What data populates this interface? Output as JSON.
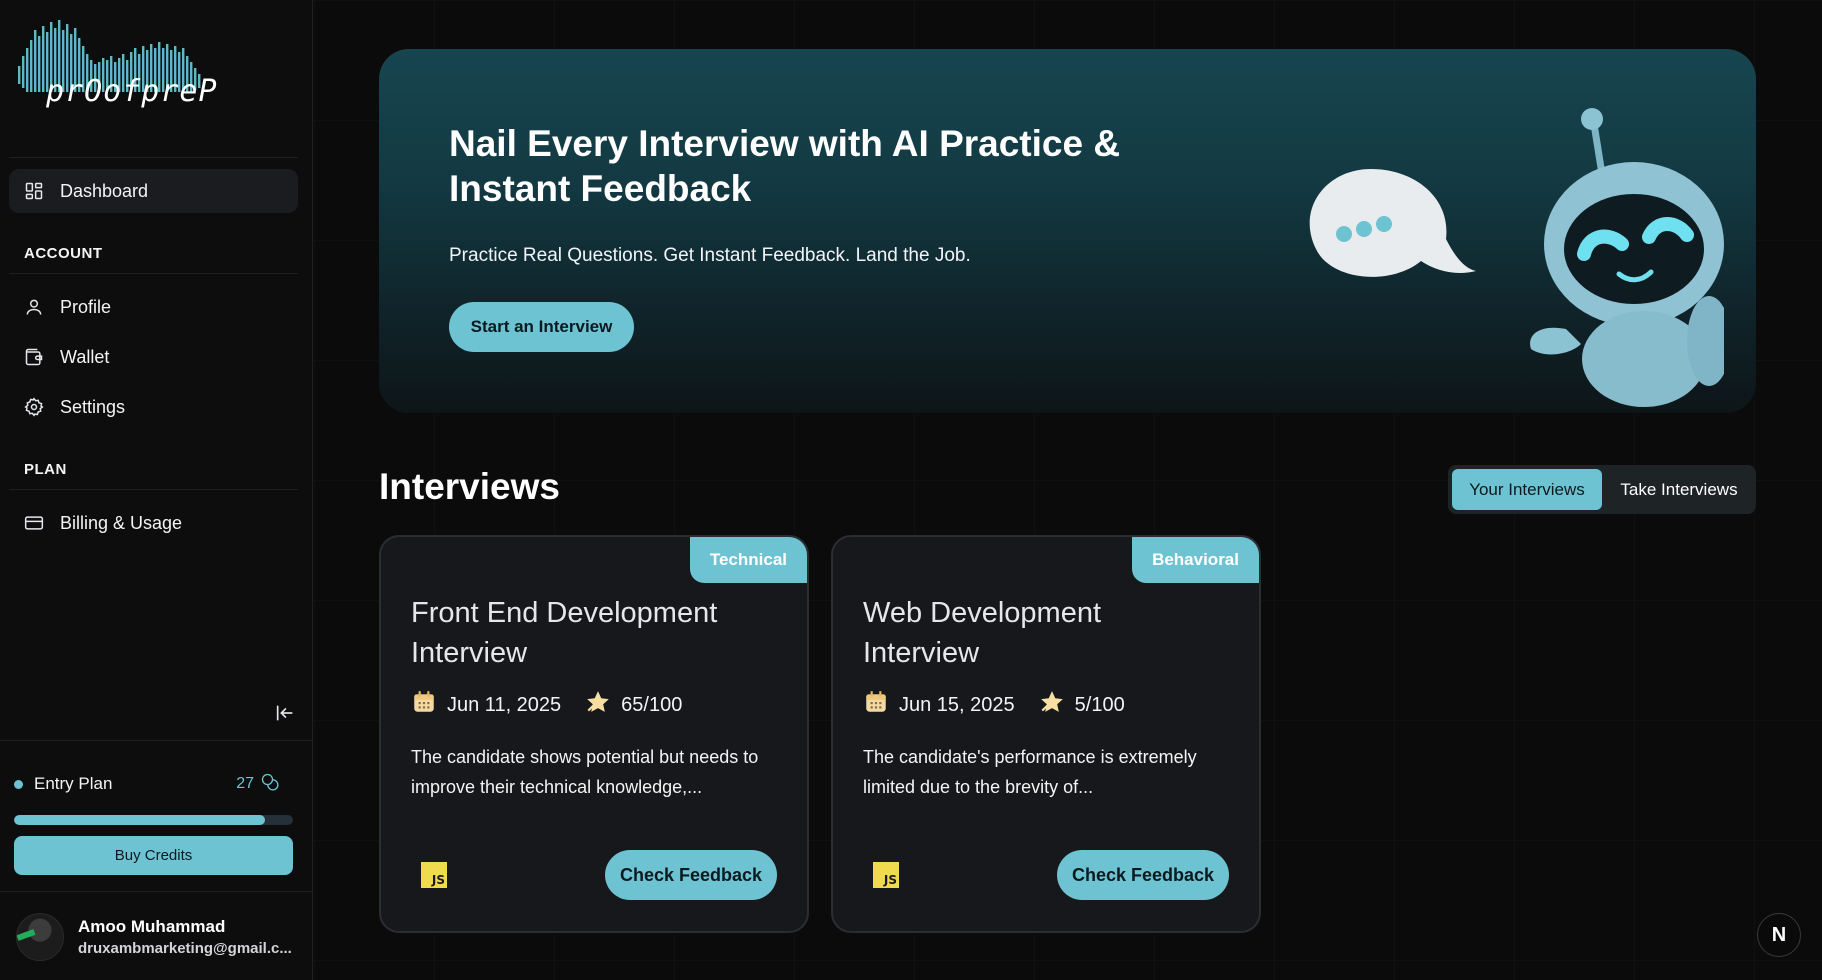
{
  "brand": {
    "logo_text": "prOofpreP"
  },
  "sidebar": {
    "dashboard_label": "Dashboard",
    "account_section": "ACCOUNT",
    "account_items": [
      {
        "label": "Profile",
        "icon": "user-icon"
      },
      {
        "label": "Wallet",
        "icon": "wallet-icon"
      },
      {
        "label": "Settings",
        "icon": "gear-icon"
      }
    ],
    "plan_section": "PLAN",
    "plan_items": [
      {
        "label": "Billing & Usage",
        "icon": "credit-card-icon"
      }
    ]
  },
  "plan": {
    "name": "Entry Plan",
    "credits": "27",
    "credits_fill_fraction": 0.9,
    "buy_label": "Buy Credits"
  },
  "user": {
    "name": "Amoo Muhammad",
    "email": "druxambmarketing@gmail.c..."
  },
  "hero": {
    "title": "Nail Every Interview with AI Practice & Instant Feedback",
    "subtitle": "Practice Real Questions. Get Instant Feedback. Land the Job.",
    "cta_label": "Start an Interview"
  },
  "interviews": {
    "heading": "Interviews",
    "tabs": [
      {
        "label": "Your Interviews",
        "active": true
      },
      {
        "label": "Take Interviews",
        "active": false
      }
    ],
    "cards": [
      {
        "tag": "Technical",
        "title": "Front End Development Interview",
        "date": "Jun 11, 2025",
        "score": "65/100",
        "description": "The candidate shows potential but needs to improve their technical knowledge,...",
        "tech": "JS",
        "button_label": "Check Feedback"
      },
      {
        "tag": "Behavioral",
        "title": "Web Development Interview",
        "date": "Jun 15, 2025",
        "score": "5/100",
        "description": "The candidate's performance is extremely limited due to the brevity of...",
        "tech": "JS",
        "button_label": "Check Feedback"
      }
    ]
  },
  "framework_badge": "N",
  "colors": {
    "accent": "#6ec3d2",
    "background": "#0b0b0c",
    "card": "#17181b",
    "hero_top": "#17454f"
  }
}
